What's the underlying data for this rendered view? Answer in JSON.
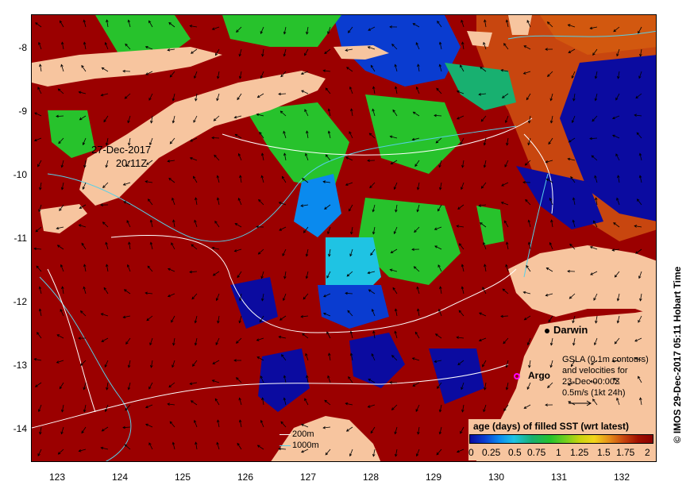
{
  "map": {
    "x_axis_ticks": [
      "123",
      "124",
      "125",
      "126",
      "127",
      "128",
      "129",
      "130",
      "131",
      "132"
    ],
    "y_axis_ticks": [
      "-8",
      "-9",
      "-10",
      "-11",
      "-12",
      "-13",
      "-14"
    ],
    "lon_range": [
      122.6,
      132.6
    ],
    "lat_range": [
      -14.5,
      -7.5
    ],
    "colors": {
      "land": "#f7c59f",
      "sst_old": "#9b0000",
      "sst_recent_green": "#27c22c",
      "sst_blue": "#0a3cd0",
      "sst_cyan": "#1fc3e3",
      "contour_white": "#ffffff",
      "contour_cyan": "#56d0e8",
      "argo_marker": "#ff00ff"
    }
  },
  "overlay": {
    "timestamp_line1": "27-Dec-2017",
    "timestamp_line2": "20:11Z",
    "darwin_label": "Darwin",
    "argo_label": "Argo",
    "credit": "© IMOS 29-Dec-2017 05:11 Hobart Time"
  },
  "gsla_note": {
    "line1": "GSLA (0.1m contours)",
    "line2": "and velocities for",
    "line3": "23-Dec 00:00Z",
    "line4": "0.5m/s (1kt 24h)"
  },
  "contour_legend": {
    "depth1": "200m",
    "depth2": "1000m"
  },
  "legend": {
    "title": "age (days) of filled SST (wrt latest)",
    "ticks": [
      "0",
      "0.25",
      "0.5",
      "0.75",
      "1",
      "1.25",
      "1.5",
      "1.75",
      "2"
    ]
  }
}
